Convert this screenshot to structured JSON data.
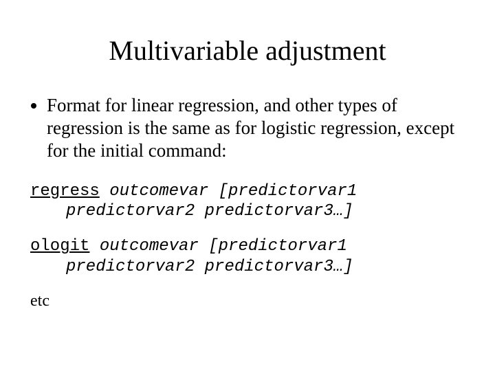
{
  "title": "Multivariable adjustment",
  "bullet": "Format for linear regression, and other types of regression is the same as for logistic regression, except for the initial command:",
  "code1": {
    "cmd": "regress",
    "line1_rest": " outcomevar [predictorvar1",
    "line2": "predictorvar2 predictorvar3…]"
  },
  "code2": {
    "cmd": "ologit",
    "line1_rest": " outcomevar [predictorvar1",
    "line2": "predictorvar2 predictorvar3…]"
  },
  "etc": "etc"
}
